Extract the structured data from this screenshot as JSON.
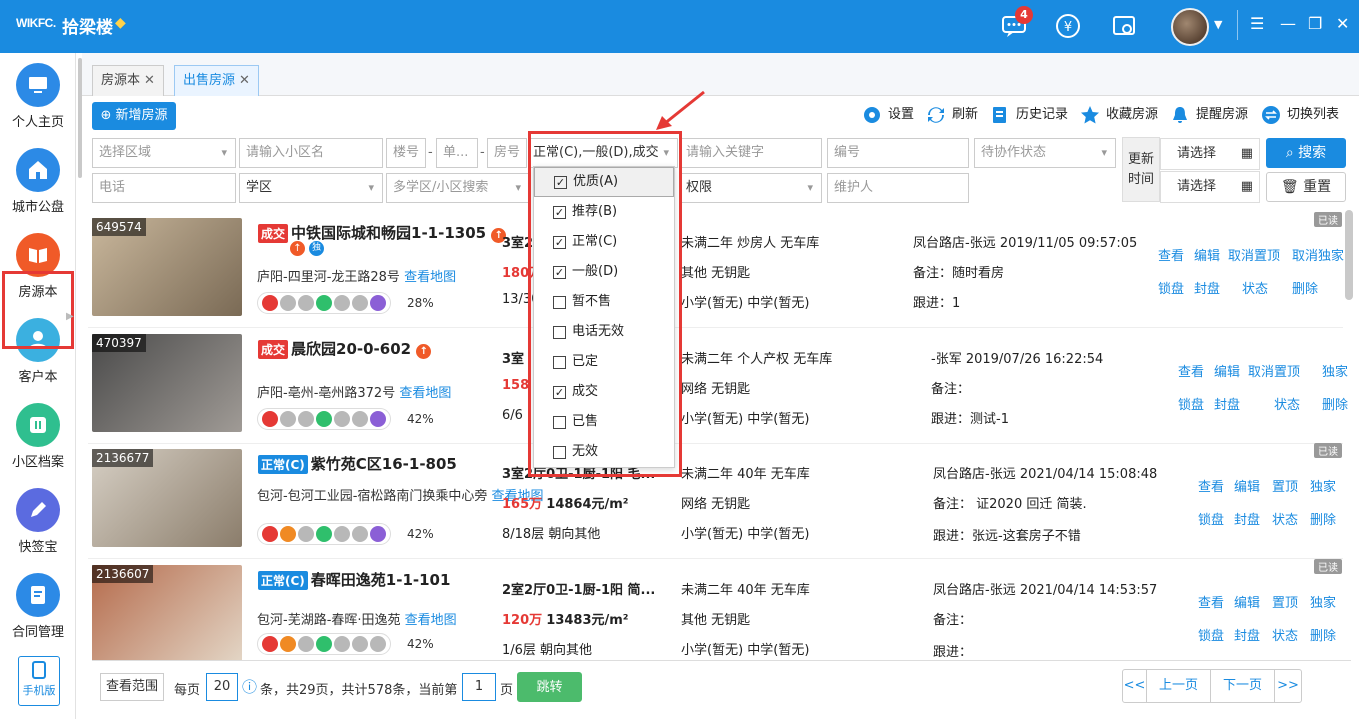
{
  "app": {
    "logo": "WIKFC.",
    "name": "拾梁楼",
    "notif_count": "4"
  },
  "sidebar": {
    "items": [
      {
        "label": "个人主页",
        "icon": "monitor-icon"
      },
      {
        "label": "城市公盘",
        "icon": "home-icon"
      },
      {
        "label": "房源本",
        "icon": "book-icon"
      },
      {
        "label": "客户本",
        "icon": "users-icon"
      },
      {
        "label": "小区档案",
        "icon": "archive-icon"
      },
      {
        "label": "快签宝",
        "icon": "pen-icon"
      },
      {
        "label": "合同管理",
        "icon": "contract-icon"
      }
    ],
    "mobile": "手机版"
  },
  "tabs": [
    {
      "label": "房源本"
    },
    {
      "label": "出售房源"
    }
  ],
  "toolbar": {
    "add": "新增房源",
    "settings": "设置",
    "refresh": "刷新",
    "history": "历史记录",
    "fav": "收藏房源",
    "remind": "提醒房源",
    "switch": "切换列表"
  },
  "filters": {
    "region": "选择区域",
    "community": "请输入小区名",
    "building": "楼号",
    "unit": "单...",
    "room": "房号",
    "status": "正常(C),一般(D),成交",
    "keyword": "请输入关键字",
    "code": "编号",
    "coop": "待协作状态",
    "phone": "电话",
    "school": "学区",
    "multi_school": "多学区/小区搜索",
    "perm": "权限",
    "maintainer": "维护人",
    "update_label": "更新时间",
    "date1": "请选择",
    "date2": "请选择",
    "search": "搜索",
    "reset": "重置"
  },
  "dropdown": {
    "options": [
      {
        "label": "优质(A)",
        "checked": true
      },
      {
        "label": "推荐(B)",
        "checked": true
      },
      {
        "label": "正常(C)",
        "checked": true
      },
      {
        "label": "一般(D)",
        "checked": true
      },
      {
        "label": "暂不售",
        "checked": false
      },
      {
        "label": "电话无效",
        "checked": false
      },
      {
        "label": "已定",
        "checked": false
      },
      {
        "label": "成交",
        "checked": true
      },
      {
        "label": "已售",
        "checked": false
      },
      {
        "label": "无效",
        "checked": false
      }
    ]
  },
  "listings": [
    {
      "id": "649574",
      "badge": "成交",
      "title": "中铁国际城和畅园1-1-1305",
      "loc": "庐阳-四里河-龙王路28号",
      "map": "查看地图",
      "pct": "28%",
      "layout": "3室2",
      "price": "180万",
      "floor": "13/30",
      "c3a": "未满二年  炒房人  无车库",
      "c3b": "其他  无钥匙",
      "c3c": "小学(暂无)  中学(暂无)",
      "agent": "凤台路店-张远  2019/11/05 09:57:05",
      "note": "备注：随时看房",
      "follow": "跟进：1",
      "actions": [
        "查看",
        "编辑",
        "取消置顶",
        "取消独家",
        "锁盘",
        "封盘",
        "状态",
        "删除"
      ],
      "read": "已读"
    },
    {
      "id": "470397",
      "badge": "成交",
      "title": "晨欣园20-0-602",
      "loc": "庐阳-亳州-亳州路372号",
      "map": "查看地图",
      "pct": "42%",
      "layout": "3室",
      "price": "158",
      "floor": "6/6",
      "c3a": "未满二年  个人产权  无车库",
      "c3b": "网络  无钥匙",
      "c3c": "小学(暂无)  中学(暂无)",
      "agent": "-张军  2019/07/26 16:22:54",
      "note": "备注：",
      "follow": "跟进：测试-1",
      "actions": [
        "查看",
        "编辑",
        "取消置顶",
        "独家",
        "锁盘",
        "封盘",
        "状态",
        "删除"
      ],
      "read": ""
    },
    {
      "id": "2136677",
      "badge": "正常(C)",
      "title": "紫竹苑C区16-1-805",
      "loc": "包河-包河工业园-宿松路南门换乘中心旁",
      "map": "查看地图",
      "pct": "42%",
      "layout": "3室2厅0卫-1厨-1阳  毛...",
      "price": "165万",
      "unitprice": "14864元/m²",
      "floor": "8/18层  朝向其他",
      "c3a": "未满二年  40年  无车库",
      "c3b": "网络  无钥匙",
      "c3c": "小学(暂无)  中学(暂无)",
      "agent": "凤台路店-张远  2021/04/14 15:08:48",
      "note": "备注：  证2020 回迁  简装.",
      "follow": "跟进：张远-这套房子不错",
      "actions": [
        "查看",
        "编辑",
        "置顶",
        "独家",
        "锁盘",
        "封盘",
        "状态",
        "删除"
      ],
      "read": "已读"
    },
    {
      "id": "2136607",
      "badge": "正常(C)",
      "title": "春晖田逸苑1-1-101",
      "loc": "包河-芜湖路-春晖·田逸苑",
      "map": "查看地图",
      "pct": "42%",
      "layout": "2室2厅0卫-1厨-1阳  简...",
      "price": "120万",
      "unitprice": "13483元/m²",
      "floor": "1/6层  朝向其他",
      "c3a": "未满二年  40年  无车库",
      "c3b": "其他  无钥匙",
      "c3c": "小学(暂无)  中学(暂无)",
      "agent": "凤台路店-张远  2021/04/14 14:53:57",
      "note": "备注：",
      "follow": "跟进：",
      "actions": [
        "查看",
        "编辑",
        "置顶",
        "独家",
        "锁盘",
        "封盘",
        "状态",
        "删除"
      ],
      "read": "已读"
    }
  ],
  "footer": {
    "scope": "查看范围",
    "perpage": "每页",
    "size": "20",
    "summary": "条，共29页，共计578条，当前第",
    "page": "1",
    "pageunit": "页",
    "jump": "跳转",
    "first": "<<",
    "prev": "上一页",
    "next": "下一页",
    "last": ">>"
  },
  "colors": {
    "primary": "#1a8be0",
    "deal": "#e53935",
    "normal": "#1a8be0",
    "highlight": "#e53935"
  }
}
